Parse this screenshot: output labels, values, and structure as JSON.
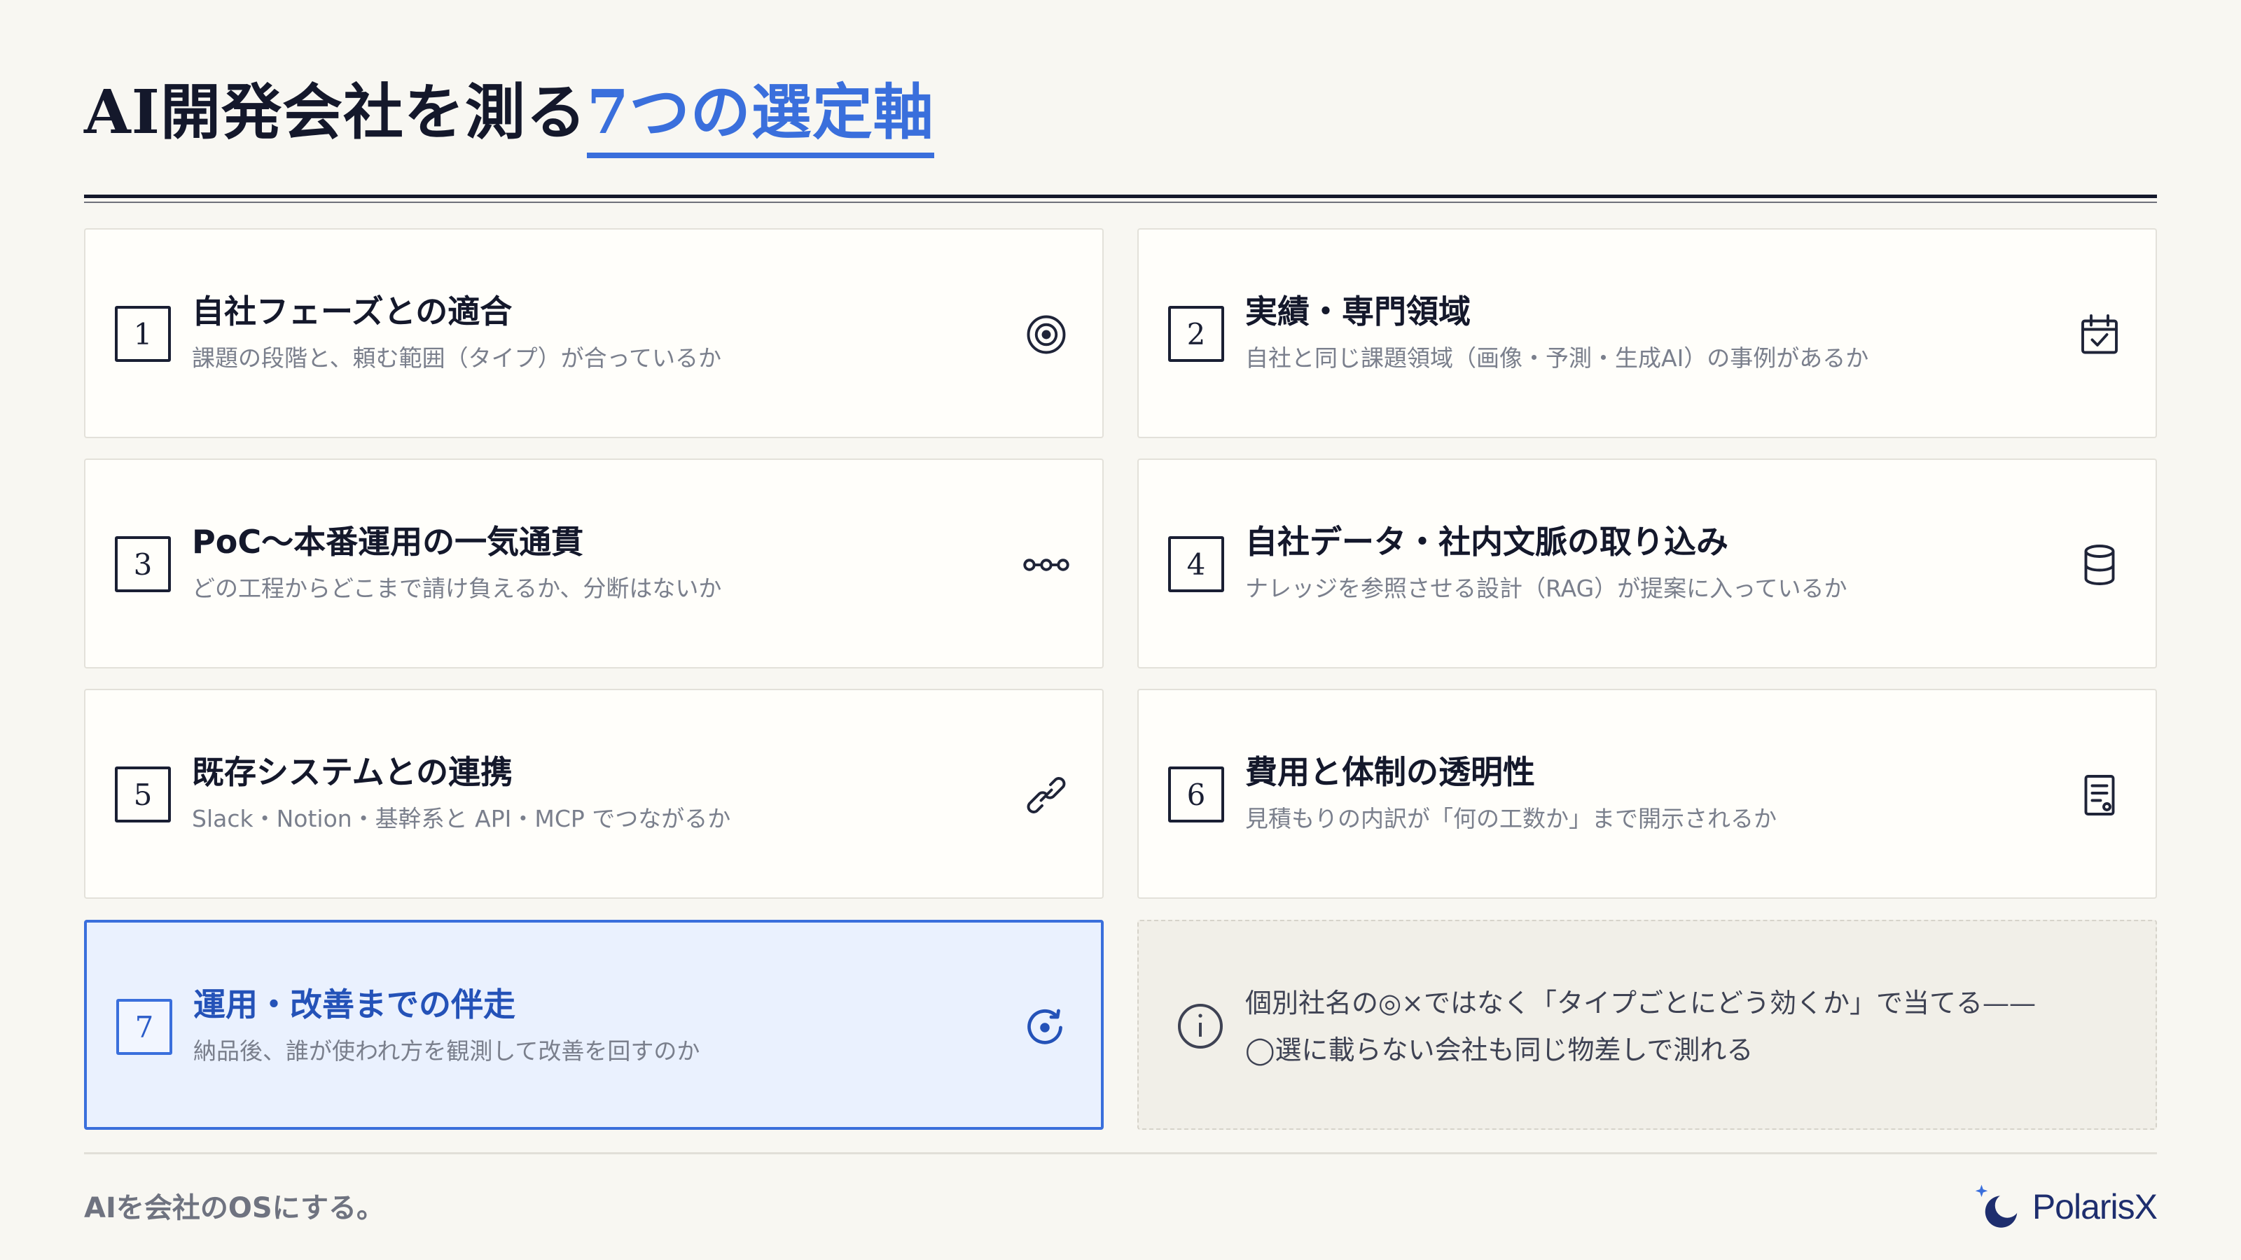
{
  "header": {
    "title_main": "AI開発会社を測る",
    "title_accent": "7つの選定軸"
  },
  "cards": [
    {
      "number": "1",
      "title": "自社フェーズとの適合",
      "description": "課題の段階と、頼む範囲（タイプ）が合っているか",
      "icon": "target-icon"
    },
    {
      "number": "2",
      "title": "実績・専門領域",
      "description": "自社と同じ課題領域（画像・予測・生成AI）の事例があるか",
      "icon": "calendar-check-icon"
    },
    {
      "number": "3",
      "title": "PoC〜本番運用の一気通貫",
      "description": "どの工程からどこまで請け負えるか、分断はないか",
      "icon": "nodes-chain-icon"
    },
    {
      "number": "4",
      "title": "自社データ・社内文脈の取り込み",
      "description": "ナレッジを参照させる設計（RAG）が提案に入っているか",
      "icon": "database-icon"
    },
    {
      "number": "5",
      "title": "既存システムとの連携",
      "description": "Slack・Notion・基幹系と API・MCP でつながるか",
      "icon": "link-icon"
    },
    {
      "number": "6",
      "title": "費用と体制の透明性",
      "description": "見積もりの内訳が「何の工数か」まで開示されるか",
      "icon": "document-list-icon"
    },
    {
      "number": "7",
      "title": "運用・改善までの伴走",
      "description": "納品後、誰が使われ方を観測して改善を回すのか",
      "icon": "refresh-cycle-icon"
    }
  ],
  "note": {
    "line1": "個別社名の◎×ではなく「タイプごとにどう効くか」で当てる——",
    "line2": "◯選に載らない会社も同じ物差しで測れる",
    "icon": "info-icon"
  },
  "footer": {
    "tagline": "AIを会社のOSにする。",
    "brand": "PolarisX"
  },
  "colors": {
    "accent": "#3a6fdc",
    "ink": "#14182b",
    "background": "#f8f7f2"
  }
}
